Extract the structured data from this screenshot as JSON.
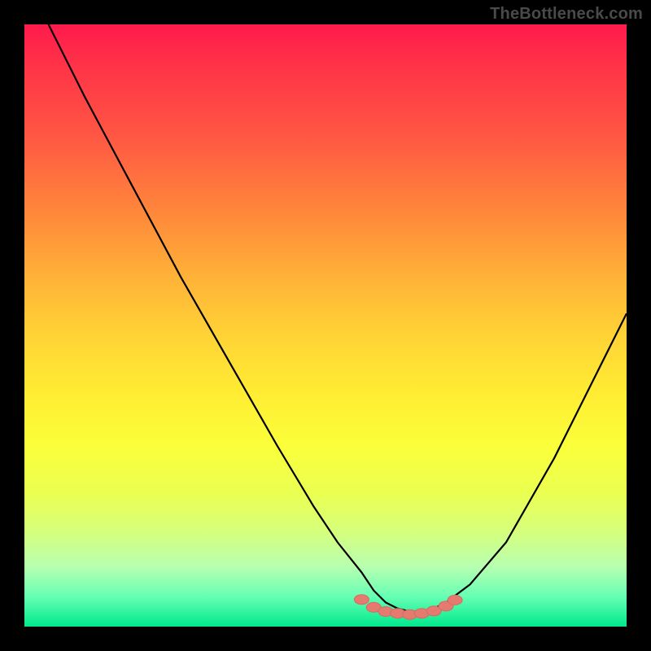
{
  "watermark": "TheBottleneck.com",
  "colors": {
    "frame": "#000000",
    "curve_stroke": "#000000",
    "marker_fill": "#e47a70",
    "marker_stroke": "#d86a60"
  },
  "chart_data": {
    "type": "line",
    "title": "",
    "xlabel": "",
    "ylabel": "",
    "xlim": [
      0,
      100
    ],
    "ylim": [
      0,
      100
    ],
    "grid": false,
    "legend": false,
    "series": [
      {
        "name": "bottleneck-curve",
        "x": [
          4,
          10,
          18,
          26,
          34,
          42,
          48,
          52,
          56,
          58,
          60,
          62,
          64,
          66,
          68,
          70,
          74,
          80,
          88,
          96,
          100
        ],
        "values": [
          100,
          88,
          73,
          58,
          44,
          30,
          20,
          14,
          9,
          6,
          4,
          3,
          2.5,
          2.5,
          3,
          4,
          7,
          14,
          28,
          44,
          52
        ]
      }
    ],
    "markers": {
      "name": "valley-points",
      "x": [
        56,
        58,
        60,
        62,
        64,
        66,
        68,
        70,
        71.5
      ],
      "values": [
        4.5,
        3.2,
        2.5,
        2.2,
        2.0,
        2.2,
        2.6,
        3.4,
        4.4
      ]
    }
  }
}
